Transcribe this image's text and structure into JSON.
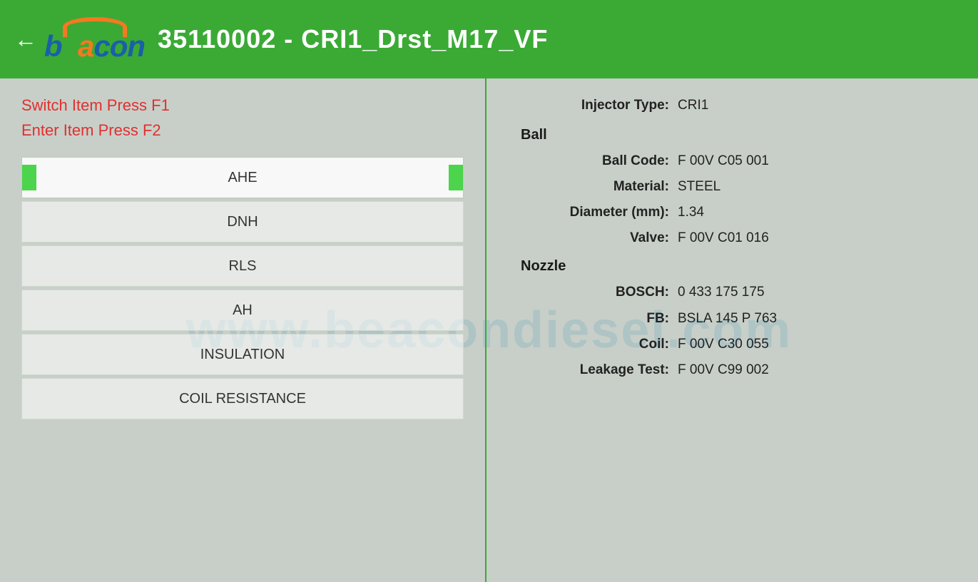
{
  "header": {
    "back_label": "←",
    "title": "35110002 - CRI1_Drst_M17_VF",
    "logo_text": "beacon"
  },
  "instructions": {
    "line1": "Switch Item Press F1",
    "line2": "Enter Item Press F2"
  },
  "menu": {
    "items": [
      {
        "label": "AHE",
        "active": true
      },
      {
        "label": "DNH",
        "active": false
      },
      {
        "label": "RLS",
        "active": false
      },
      {
        "label": "AH",
        "active": false
      },
      {
        "label": "INSULATION",
        "active": false
      },
      {
        "label": "COIL RESISTANCE",
        "active": false
      }
    ]
  },
  "details": {
    "injector_type_label": "Injector Type:",
    "injector_type_value": "CRI1",
    "ball_label": "Ball",
    "ball_code_label": "Ball Code:",
    "ball_code_value": "F 00V C05 001",
    "material_label": "Material:",
    "material_value": "STEEL",
    "diameter_label": "Diameter (mm):",
    "diameter_value": "1.34",
    "valve_label": "Valve:",
    "valve_value": "F 00V C01 016",
    "nozzle_label": "Nozzle",
    "bosch_label": "BOSCH:",
    "bosch_value": "0 433 175 175",
    "fb_label": "FB:",
    "fb_value": "BSLA 145 P 763",
    "coil_label": "Coil:",
    "coil_value": "F 00V C30 055",
    "leakage_label": "Leakage Test:",
    "leakage_value": "F 00V C99 002"
  },
  "watermark": "www.beacondiesel.com",
  "colors": {
    "header_green": "#3aaa35",
    "indicator_green": "#4cd44c",
    "red_text": "#e03030",
    "divider_green": "#3aaa35"
  }
}
